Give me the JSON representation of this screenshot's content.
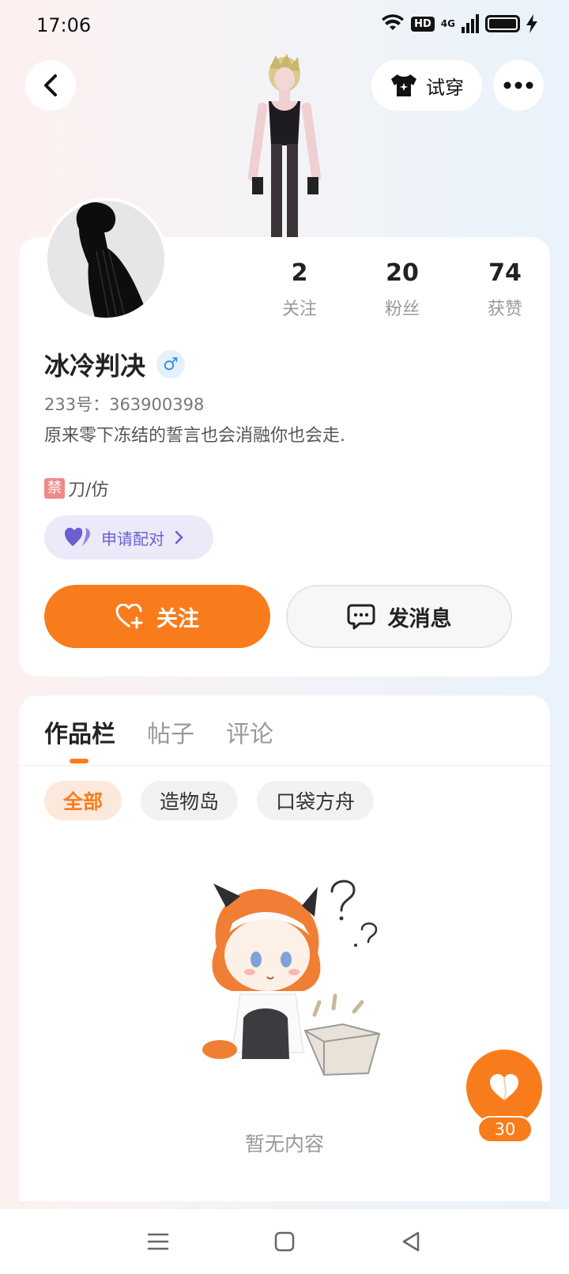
{
  "status_bar": {
    "time": "17:06",
    "hd": "HD",
    "network": "4G"
  },
  "header": {
    "try_on_label": "试穿"
  },
  "profile": {
    "stats": [
      {
        "value": "2",
        "label": "关注"
      },
      {
        "value": "20",
        "label": "粉丝"
      },
      {
        "value": "74",
        "label": "获赞"
      }
    ],
    "username": "冰冷判决",
    "gender_symbol": "♂",
    "uid": "233号：363900398",
    "bio": "原来零下冻结的誓言也会消融你也会走.",
    "bio_tag_badge": "禁",
    "bio_tag_text": "刀/仿",
    "pair_label": "申请配对",
    "follow_label": "关注",
    "message_label": "发消息"
  },
  "works": {
    "tabs": [
      "作品栏",
      "帖子",
      "评论"
    ],
    "chips": [
      "全部",
      "造物岛",
      "口袋方舟"
    ],
    "empty_text": "暂无内容"
  },
  "like_count": "30",
  "colors": {
    "accent": "#f97c1c",
    "pair": "#6b5fd2"
  }
}
